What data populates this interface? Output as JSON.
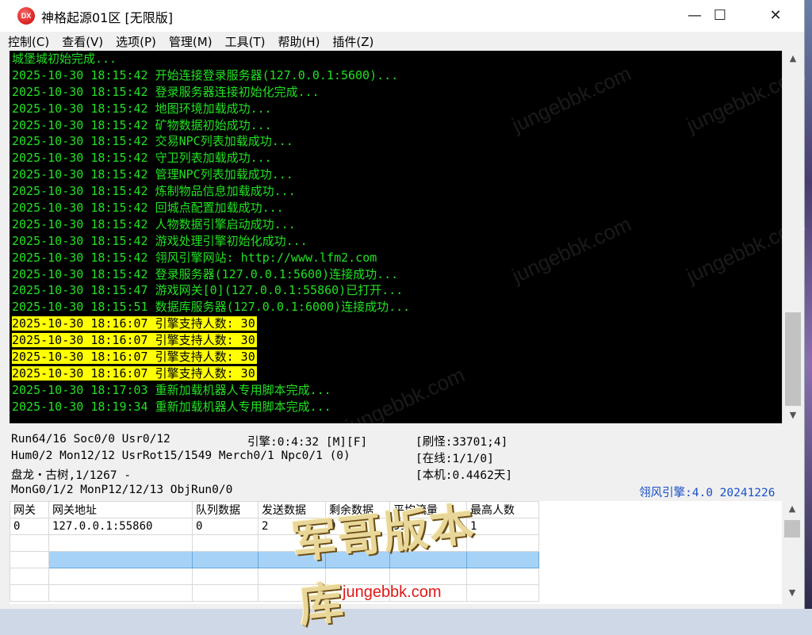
{
  "window": {
    "title": "神格起源01区 [无限版]",
    "icon_label": "DX",
    "minimize": "—",
    "maximize": "☐",
    "close": "✕"
  },
  "menu": [
    {
      "label": "控制(C)"
    },
    {
      "label": "查看(V)"
    },
    {
      "label": "选项(P)"
    },
    {
      "label": "管理(M)"
    },
    {
      "label": "工具(T)"
    },
    {
      "label": "帮助(H)"
    },
    {
      "label": "插件(Z)"
    }
  ],
  "log": [
    {
      "text": "城堡城初始完成...",
      "highlight": false
    },
    {
      "text": "2025-10-30 18:15:42 开始连接登录服务器(127.0.0.1:5600)...",
      "highlight": false
    },
    {
      "text": "2025-10-30 18:15:42 登录服务器连接初始化完成...",
      "highlight": false
    },
    {
      "text": "2025-10-30 18:15:42 地图环境加载成功...",
      "highlight": false
    },
    {
      "text": "2025-10-30 18:15:42 矿物数据初始成功...",
      "highlight": false
    },
    {
      "text": "2025-10-30 18:15:42 交易NPC列表加载成功...",
      "highlight": false
    },
    {
      "text": "2025-10-30 18:15:42 守卫列表加载成功...",
      "highlight": false
    },
    {
      "text": "2025-10-30 18:15:42 管理NPC列表加载成功...",
      "highlight": false
    },
    {
      "text": "2025-10-30 18:15:42 炼制物品信息加载成功...",
      "highlight": false
    },
    {
      "text": "2025-10-30 18:15:42 回城点配置加载成功...",
      "highlight": false
    },
    {
      "text": "2025-10-30 18:15:42 人物数据引擎启动成功...",
      "highlight": false
    },
    {
      "text": "2025-10-30 18:15:42 游戏处理引擎初始化成功...",
      "highlight": false
    },
    {
      "text": "2025-10-30 18:15:42 翎风引擎网站: http://www.lfm2.com",
      "highlight": false
    },
    {
      "text": "2025-10-30 18:15:42 登录服务器(127.0.0.1:5600)连接成功...",
      "highlight": false
    },
    {
      "text": "2025-10-30 18:15:47 游戏网关[0](127.0.0.1:55860)已打开...",
      "highlight": false
    },
    {
      "text": "2025-10-30 18:15:51 数据库服务器(127.0.0.1:6000)连接成功...",
      "highlight": false
    },
    {
      "text": "2025-10-30 18:16:07 引擎支持人数: 30",
      "highlight": true
    },
    {
      "text": "2025-10-30 18:16:07 引擎支持人数: 30",
      "highlight": true
    },
    {
      "text": "2025-10-30 18:16:07 引擎支持人数: 30",
      "highlight": true
    },
    {
      "text": "2025-10-30 18:16:07 引擎支持人数: 30",
      "highlight": true
    },
    {
      "text": "2025-10-30 18:17:03 重新加载机器人专用脚本完成...",
      "highlight": false
    },
    {
      "text": "2025-10-30 18:19:34 重新加载机器人专用脚本完成...",
      "highlight": false
    }
  ],
  "status": {
    "row1_left": "Run64/16 Soc0/0 Usr0/12",
    "row1_mid": "引擎:0:4:32 [M][F]",
    "row1_right": "[刷怪:33701;4]",
    "row2_left": "Hum0/2 Mon12/12 UsrRot15/1549 Merch0/1 Npc0/1 (0)",
    "row2_right": "[在线:1/1/0]",
    "row3_left": "盘龙・古树,1/1267 -",
    "row3_right": "[本机:0.4462天]",
    "row4_left": "MonG0/1/2 MonP12/12/13 ObjRun0/0",
    "version": "翎风引擎:4.0 20241226"
  },
  "gateway_table": {
    "headers": [
      "网关",
      "网关地址",
      "队列数据",
      "发送数据",
      "剩余数据",
      "平均流量",
      "最高人数"
    ],
    "rows": [
      [
        "0",
        "127.0.0.1:55860",
        "0",
        "2",
        "0",
        "91b",
        "1"
      ]
    ]
  },
  "watermarks": {
    "site": "jungebbk.com",
    "logo": "军哥版本库",
    "url": "jungebbk.com"
  },
  "colors": {
    "console_bg": "#000000",
    "console_text": "#22e022",
    "highlight_bg": "#ffff00",
    "version_text": "#1850c8",
    "selection": "#a6d2f7"
  }
}
